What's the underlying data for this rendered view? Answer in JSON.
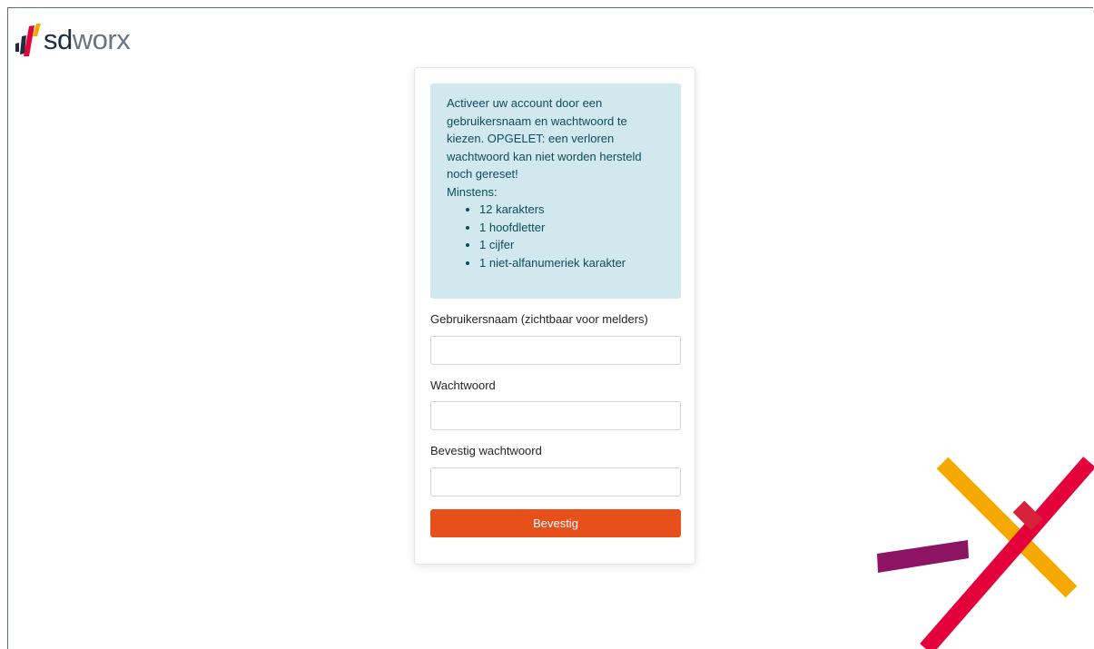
{
  "brand": {
    "logo_sd": "sd",
    "logo_worx": "worx",
    "colors": {
      "logo_dark": "#1e2c3d",
      "logo_grey": "#6b7380",
      "logo_red": "#e4003a",
      "logo_yellow": "#f5a800",
      "logo_purple": "#8c1463"
    }
  },
  "notice": {
    "intro": "Activeer uw account door een gebruikersnaam en wachtwoord te kiezen. OPGELET: een verloren wachtwoord kan niet worden hersteld noch gereset!",
    "minimum_label": "Minstens:",
    "requirements": [
      "12 karakters",
      "1 hoofdletter",
      "1 cijfer",
      "1 niet-alfanumeriek karakter"
    ]
  },
  "form": {
    "username_label": "Gebruikersnaam (zichtbaar voor melders)",
    "username_value": "",
    "password_label": "Wachtwoord",
    "password_value": "",
    "confirm_password_label": "Bevestig wachtwoord",
    "confirm_password_value": "",
    "submit_label": "Bevestig",
    "submit_color": "#e8501b"
  }
}
